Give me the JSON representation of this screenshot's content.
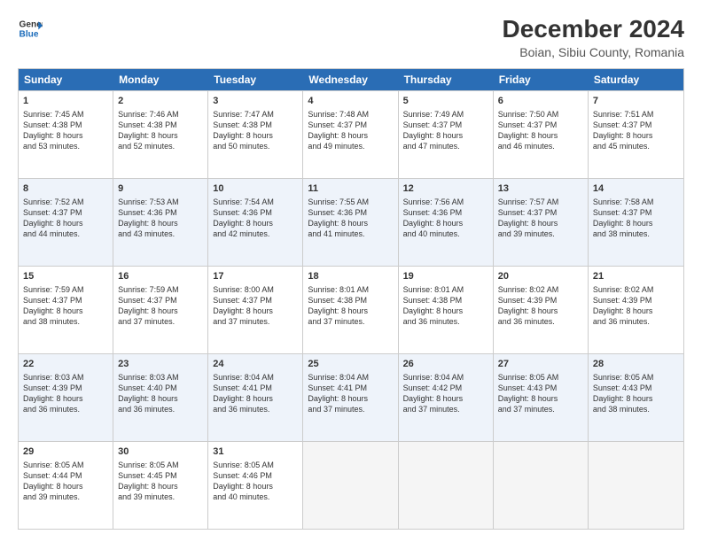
{
  "logo": {
    "line1": "General",
    "line2": "Blue",
    "arrow_color": "#1a6bba"
  },
  "title": "December 2024",
  "subtitle": "Boian, Sibiu County, Romania",
  "header_days": [
    "Sunday",
    "Monday",
    "Tuesday",
    "Wednesday",
    "Thursday",
    "Friday",
    "Saturday"
  ],
  "weeks": [
    [
      {
        "day": "1",
        "lines": [
          "Sunrise: 7:45 AM",
          "Sunset: 4:38 PM",
          "Daylight: 8 hours",
          "and 53 minutes."
        ]
      },
      {
        "day": "2",
        "lines": [
          "Sunrise: 7:46 AM",
          "Sunset: 4:38 PM",
          "Daylight: 8 hours",
          "and 52 minutes."
        ]
      },
      {
        "day": "3",
        "lines": [
          "Sunrise: 7:47 AM",
          "Sunset: 4:38 PM",
          "Daylight: 8 hours",
          "and 50 minutes."
        ]
      },
      {
        "day": "4",
        "lines": [
          "Sunrise: 7:48 AM",
          "Sunset: 4:37 PM",
          "Daylight: 8 hours",
          "and 49 minutes."
        ]
      },
      {
        "day": "5",
        "lines": [
          "Sunrise: 7:49 AM",
          "Sunset: 4:37 PM",
          "Daylight: 8 hours",
          "and 47 minutes."
        ]
      },
      {
        "day": "6",
        "lines": [
          "Sunrise: 7:50 AM",
          "Sunset: 4:37 PM",
          "Daylight: 8 hours",
          "and 46 minutes."
        ]
      },
      {
        "day": "7",
        "lines": [
          "Sunrise: 7:51 AM",
          "Sunset: 4:37 PM",
          "Daylight: 8 hours",
          "and 45 minutes."
        ]
      }
    ],
    [
      {
        "day": "8",
        "lines": [
          "Sunrise: 7:52 AM",
          "Sunset: 4:37 PM",
          "Daylight: 8 hours",
          "and 44 minutes."
        ]
      },
      {
        "day": "9",
        "lines": [
          "Sunrise: 7:53 AM",
          "Sunset: 4:36 PM",
          "Daylight: 8 hours",
          "and 43 minutes."
        ]
      },
      {
        "day": "10",
        "lines": [
          "Sunrise: 7:54 AM",
          "Sunset: 4:36 PM",
          "Daylight: 8 hours",
          "and 42 minutes."
        ]
      },
      {
        "day": "11",
        "lines": [
          "Sunrise: 7:55 AM",
          "Sunset: 4:36 PM",
          "Daylight: 8 hours",
          "and 41 minutes."
        ]
      },
      {
        "day": "12",
        "lines": [
          "Sunrise: 7:56 AM",
          "Sunset: 4:36 PM",
          "Daylight: 8 hours",
          "and 40 minutes."
        ]
      },
      {
        "day": "13",
        "lines": [
          "Sunrise: 7:57 AM",
          "Sunset: 4:37 PM",
          "Daylight: 8 hours",
          "and 39 minutes."
        ]
      },
      {
        "day": "14",
        "lines": [
          "Sunrise: 7:58 AM",
          "Sunset: 4:37 PM",
          "Daylight: 8 hours",
          "and 38 minutes."
        ]
      }
    ],
    [
      {
        "day": "15",
        "lines": [
          "Sunrise: 7:59 AM",
          "Sunset: 4:37 PM",
          "Daylight: 8 hours",
          "and 38 minutes."
        ]
      },
      {
        "day": "16",
        "lines": [
          "Sunrise: 7:59 AM",
          "Sunset: 4:37 PM",
          "Daylight: 8 hours",
          "and 37 minutes."
        ]
      },
      {
        "day": "17",
        "lines": [
          "Sunrise: 8:00 AM",
          "Sunset: 4:37 PM",
          "Daylight: 8 hours",
          "and 37 minutes."
        ]
      },
      {
        "day": "18",
        "lines": [
          "Sunrise: 8:01 AM",
          "Sunset: 4:38 PM",
          "Daylight: 8 hours",
          "and 37 minutes."
        ]
      },
      {
        "day": "19",
        "lines": [
          "Sunrise: 8:01 AM",
          "Sunset: 4:38 PM",
          "Daylight: 8 hours",
          "and 36 minutes."
        ]
      },
      {
        "day": "20",
        "lines": [
          "Sunrise: 8:02 AM",
          "Sunset: 4:39 PM",
          "Daylight: 8 hours",
          "and 36 minutes."
        ]
      },
      {
        "day": "21",
        "lines": [
          "Sunrise: 8:02 AM",
          "Sunset: 4:39 PM",
          "Daylight: 8 hours",
          "and 36 minutes."
        ]
      }
    ],
    [
      {
        "day": "22",
        "lines": [
          "Sunrise: 8:03 AM",
          "Sunset: 4:39 PM",
          "Daylight: 8 hours",
          "and 36 minutes."
        ]
      },
      {
        "day": "23",
        "lines": [
          "Sunrise: 8:03 AM",
          "Sunset: 4:40 PM",
          "Daylight: 8 hours",
          "and 36 minutes."
        ]
      },
      {
        "day": "24",
        "lines": [
          "Sunrise: 8:04 AM",
          "Sunset: 4:41 PM",
          "Daylight: 8 hours",
          "and 36 minutes."
        ]
      },
      {
        "day": "25",
        "lines": [
          "Sunrise: 8:04 AM",
          "Sunset: 4:41 PM",
          "Daylight: 8 hours",
          "and 37 minutes."
        ]
      },
      {
        "day": "26",
        "lines": [
          "Sunrise: 8:04 AM",
          "Sunset: 4:42 PM",
          "Daylight: 8 hours",
          "and 37 minutes."
        ]
      },
      {
        "day": "27",
        "lines": [
          "Sunrise: 8:05 AM",
          "Sunset: 4:43 PM",
          "Daylight: 8 hours",
          "and 37 minutes."
        ]
      },
      {
        "day": "28",
        "lines": [
          "Sunrise: 8:05 AM",
          "Sunset: 4:43 PM",
          "Daylight: 8 hours",
          "and 38 minutes."
        ]
      }
    ],
    [
      {
        "day": "29",
        "lines": [
          "Sunrise: 8:05 AM",
          "Sunset: 4:44 PM",
          "Daylight: 8 hours",
          "and 39 minutes."
        ]
      },
      {
        "day": "30",
        "lines": [
          "Sunrise: 8:05 AM",
          "Sunset: 4:45 PM",
          "Daylight: 8 hours",
          "and 39 minutes."
        ]
      },
      {
        "day": "31",
        "lines": [
          "Sunrise: 8:05 AM",
          "Sunset: 4:46 PM",
          "Daylight: 8 hours",
          "and 40 minutes."
        ]
      },
      null,
      null,
      null,
      null
    ]
  ]
}
